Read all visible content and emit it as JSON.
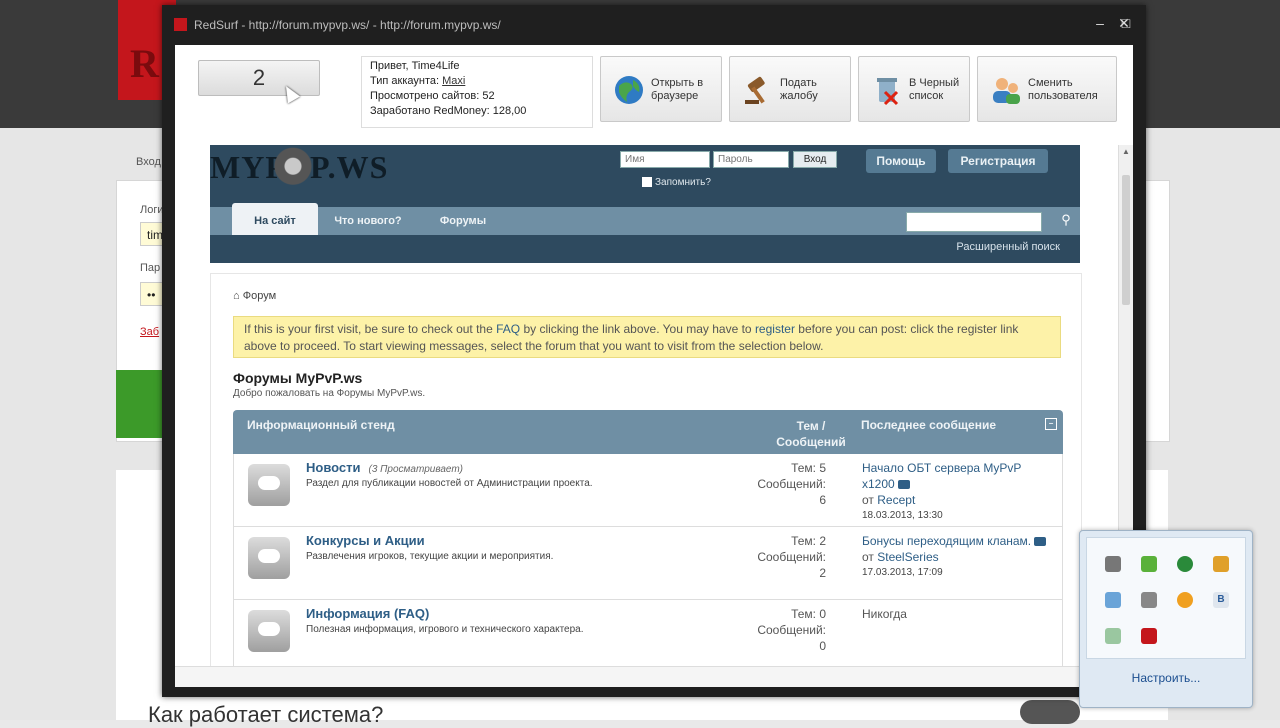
{
  "window": {
    "title": "RedSurf - http://forum.mypvp.ws/ - http://forum.mypvp.ws/",
    "minimize": "–",
    "maximize": "□",
    "close": "✕"
  },
  "toolbar": {
    "counter": "2",
    "account": {
      "greeting": "Привет, Time4Life",
      "type_label": "Тип аккаунта:",
      "type_value": "Maxi",
      "viewed": "Просмотрено сайтов: 52",
      "earned": "Заработано RedMoney: 128,00"
    },
    "buttons": [
      {
        "label1": "Открыть в",
        "label2": "браузере",
        "icon": "globe-icon"
      },
      {
        "label1": "Подать",
        "label2": "жалобу",
        "icon": "gavel-icon"
      },
      {
        "label1": "В Черный",
        "label2": "список",
        "icon": "trash-block-icon"
      },
      {
        "label1": "Сменить",
        "label2": "пользователя",
        "icon": "users-icon"
      }
    ]
  },
  "forum": {
    "logo": "MYPVP.WS",
    "login": {
      "name_placeholder": "Имя",
      "password_placeholder": "Пароль",
      "submit": "Вход",
      "remember": "Запомнить?"
    },
    "help": "Помощь",
    "register": "Регистрация",
    "nav": [
      "На сайт",
      "Что нового?",
      "Форумы"
    ],
    "advanced_search": "Расширенный поиск",
    "breadcrumb": "Форум",
    "notice": {
      "t1": "If this is your first visit, be sure to check out the ",
      "faq": "FAQ",
      "t2": " by clicking the link above. You may have to ",
      "register": "register",
      "t3": " before you can post: click the register link above to proceed. To start viewing messages, select the forum that you want to visit from the selection below."
    },
    "title": "Форумы MyPvP.ws",
    "subtitle": "Добро пожаловать на Форумы MyPvP.ws.",
    "table": {
      "col1": "Информационный стенд",
      "col2": "Тем / Сообщений",
      "col3": "Последнее сообщение",
      "rows": [
        {
          "name": "Новости",
          "viewers": "(3 Просматривает)",
          "desc": "Раздел для публикации новостей от Администрации проекта.",
          "topics": "Тем: 5",
          "posts_label": "Сообщений:",
          "posts": "6",
          "last_title": "Начало ОБТ сервера MyPvP x1200",
          "last_from": "от",
          "last_user": "Recept",
          "last_date": "18.03.2013, 13:30"
        },
        {
          "name": "Конкурсы и Акции",
          "viewers": "",
          "desc": "Развлечения игроков, текущие акции и мероприятия.",
          "topics": "Тем: 2",
          "posts_label": "Сообщений:",
          "posts": "2",
          "last_title": "Бонусы переходящим кланам.",
          "last_from": "от",
          "last_user": "SteelSeries",
          "last_date": "17.03.2013, 17:09"
        },
        {
          "name": "Информация (FAQ)",
          "viewers": "",
          "desc": "Полезная информация, игрового и технического характера.",
          "topics": "Тем: 0",
          "posts_label": "Сообщений:",
          "posts": "0",
          "last_title": "",
          "last_never": "Никогда"
        }
      ]
    }
  },
  "background": {
    "logo": "R",
    "login_link": "Вход",
    "label1": "Логи",
    "input1": "tim",
    "label2": "Пар",
    "input2": "••",
    "link": "Заб",
    "heading": "Как работает система?"
  },
  "tray": {
    "customize": "Настроить..."
  },
  "colors": {
    "brand_red": "#c4161c",
    "forum_header": "#2e4a5f",
    "forum_nav": "#6f8fa4",
    "link": "#2e5e86",
    "notice_bg": "#fdf2a8"
  }
}
